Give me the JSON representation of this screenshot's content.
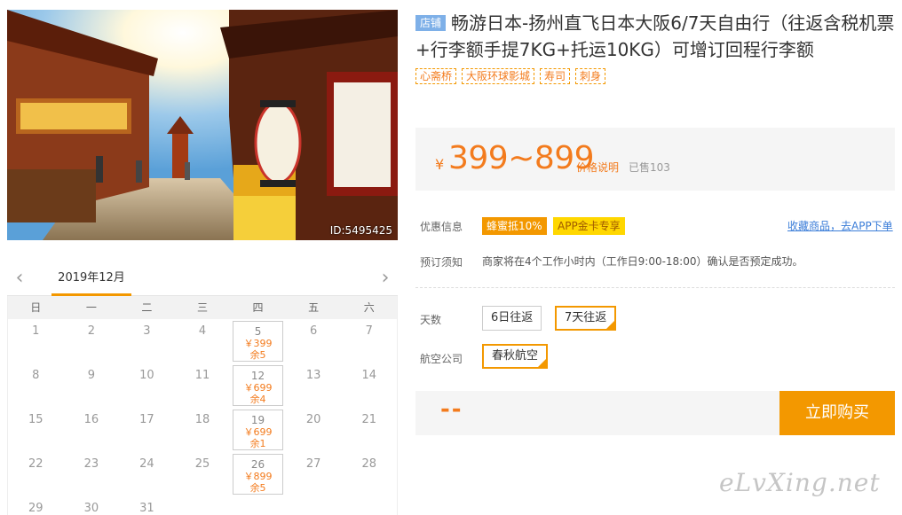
{
  "hero": {
    "id_label": "ID:5495425"
  },
  "calendar": {
    "month_label": "2019年12月",
    "weekdays": [
      "日",
      "一",
      "二",
      "三",
      "四",
      "五",
      "六"
    ],
    "days": [
      {
        "d": "1"
      },
      {
        "d": "2"
      },
      {
        "d": "3"
      },
      {
        "d": "4"
      },
      {
        "d": "5",
        "price": "￥399",
        "stock": "余5"
      },
      {
        "d": "6"
      },
      {
        "d": "7"
      },
      {
        "d": "8"
      },
      {
        "d": "9"
      },
      {
        "d": "10"
      },
      {
        "d": "11"
      },
      {
        "d": "12",
        "price": "￥699",
        "stock": "余4"
      },
      {
        "d": "13"
      },
      {
        "d": "14"
      },
      {
        "d": "15"
      },
      {
        "d": "16"
      },
      {
        "d": "17"
      },
      {
        "d": "18"
      },
      {
        "d": "19",
        "price": "￥699",
        "stock": "余1"
      },
      {
        "d": "20"
      },
      {
        "d": "21"
      },
      {
        "d": "22"
      },
      {
        "d": "23"
      },
      {
        "d": "24"
      },
      {
        "d": "25"
      },
      {
        "d": "26",
        "price": "￥899",
        "stock": "余5"
      },
      {
        "d": "27"
      },
      {
        "d": "28"
      },
      {
        "d": "29"
      },
      {
        "d": "30"
      },
      {
        "d": "31"
      }
    ]
  },
  "product": {
    "shop_badge": "店铺",
    "title": "畅游日本-扬州直飞日本大阪6/7天自由行（往返含税机票+行李额手提7KG+托运10KG）可增订回程行李额",
    "tags": [
      "心斋桥",
      "大阪环球影城",
      "寿司",
      "刺身"
    ]
  },
  "price": {
    "currency": "¥",
    "range": "399~899",
    "explain_link": "价格说明",
    "sold": "已售103"
  },
  "promo": {
    "label": "优惠信息",
    "badge1": "蜂蜜抵10%",
    "badge2": "APP金卡专享",
    "fav_link": "收藏商品，去APP下单"
  },
  "notice": {
    "label": "预订须知",
    "text": "商家将在4个工作小时内（工作日9:00-18:00）确认是否预定成功。"
  },
  "days_option": {
    "label": "天数",
    "options": [
      "6日往返",
      "7天往返"
    ],
    "selected": "7天往返"
  },
  "airline_option": {
    "label": "航空公司",
    "options": [
      "春秋航空"
    ],
    "selected": "春秋航空"
  },
  "buy": {
    "total": "--",
    "button": "立即购买"
  },
  "watermark": "eLvXing.net",
  "colors": {
    "accent": "#f39800",
    "price": "#f37b1d",
    "link": "#3b7dd8",
    "shop_badge": "#7eb0e8"
  }
}
